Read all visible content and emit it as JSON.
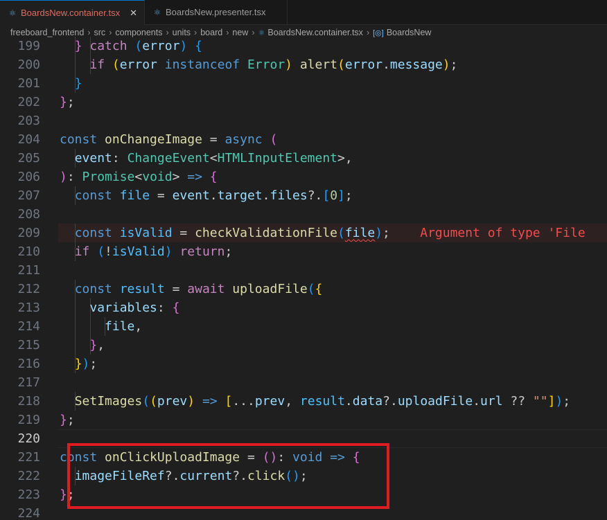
{
  "tabs": [
    {
      "label": "BoardsNew.container.tsx",
      "icon": "react-icon",
      "active": true,
      "close": "✕"
    },
    {
      "label": "BoardsNew.presenter.tsx",
      "icon": "react-icon",
      "active": false
    }
  ],
  "breadcrumb": [
    "freeboard_frontend",
    "src",
    "components",
    "units",
    "board",
    "new",
    "BoardsNew.container.tsx",
    "BoardsNew"
  ],
  "error_message": "Argument of type 'File",
  "lines": [
    {
      "n": "199",
      "t": [
        [
          "  ",
          "p"
        ],
        [
          "} ",
          "b2"
        ],
        [
          "catch ",
          "ctl"
        ],
        [
          "(",
          "b3"
        ],
        [
          "error",
          "var"
        ],
        [
          ") ",
          "b3"
        ],
        [
          "{",
          "b3"
        ]
      ]
    },
    {
      "n": "200",
      "t": [
        [
          "    ",
          "p"
        ],
        [
          "if ",
          "ctl"
        ],
        [
          "(",
          "b1"
        ],
        [
          "error ",
          "var"
        ],
        [
          "instanceof ",
          "kw"
        ],
        [
          "Error",
          "typ"
        ],
        [
          ") ",
          "b1"
        ],
        [
          "alert",
          "fn"
        ],
        [
          "(",
          "b1"
        ],
        [
          "error",
          "var"
        ],
        [
          ".",
          "p"
        ],
        [
          "message",
          "var"
        ],
        [
          ")",
          "b1"
        ],
        [
          ";",
          "p"
        ]
      ]
    },
    {
      "n": "201",
      "t": [
        [
          "  ",
          "p"
        ],
        [
          "}",
          "b3"
        ]
      ]
    },
    {
      "n": "202",
      "t": [
        [
          "}",
          "b2"
        ],
        [
          ";",
          "p"
        ]
      ]
    },
    {
      "n": "203",
      "t": []
    },
    {
      "n": "204",
      "t": [
        [
          "const ",
          "kw"
        ],
        [
          "onChangeImage",
          "fn"
        ],
        [
          " = ",
          "p"
        ],
        [
          "async ",
          "kw"
        ],
        [
          "(",
          "b2"
        ]
      ]
    },
    {
      "n": "205",
      "t": [
        [
          "  ",
          "p"
        ],
        [
          "event",
          "var"
        ],
        [
          ": ",
          "p"
        ],
        [
          "ChangeEvent",
          "typ"
        ],
        [
          "<",
          "p"
        ],
        [
          "HTMLInputElement",
          "typ"
        ],
        [
          ">",
          "p"
        ],
        [
          ",",
          "p"
        ]
      ]
    },
    {
      "n": "206",
      "t": [
        [
          ")",
          "b2"
        ],
        [
          ": ",
          "p"
        ],
        [
          "Promise",
          "typ"
        ],
        [
          "<",
          "p"
        ],
        [
          "void",
          "typ"
        ],
        [
          "> ",
          "p"
        ],
        [
          "=> ",
          "kw"
        ],
        [
          "{",
          "b2"
        ]
      ]
    },
    {
      "n": "207",
      "t": [
        [
          "  ",
          "p"
        ],
        [
          "const ",
          "kw"
        ],
        [
          "file",
          "cst"
        ],
        [
          " = ",
          "p"
        ],
        [
          "event",
          "var"
        ],
        [
          ".",
          "p"
        ],
        [
          "target",
          "var"
        ],
        [
          ".",
          "p"
        ],
        [
          "files",
          "var"
        ],
        [
          "?.",
          "p"
        ],
        [
          "[",
          "b3"
        ],
        [
          "0",
          "num"
        ],
        [
          "]",
          "b3"
        ],
        [
          ";",
          "p"
        ]
      ]
    },
    {
      "n": "208",
      "t": []
    },
    {
      "n": "209",
      "error": true,
      "t": [
        [
          "  ",
          "p"
        ],
        [
          "const ",
          "kw"
        ],
        [
          "isValid",
          "cst"
        ],
        [
          " = ",
          "p"
        ],
        [
          "checkValidationFile",
          "fn"
        ],
        [
          "(",
          "b3"
        ],
        [
          "file",
          "var squig"
        ],
        [
          ")",
          "b3"
        ],
        [
          ";",
          "p"
        ]
      ]
    },
    {
      "n": "210",
      "t": [
        [
          "  ",
          "p"
        ],
        [
          "if ",
          "ctl"
        ],
        [
          "(",
          "b3"
        ],
        [
          "!",
          "p"
        ],
        [
          "isValid",
          "cst"
        ],
        [
          ") ",
          "b3"
        ],
        [
          "return",
          "ctl"
        ],
        [
          ";",
          "p"
        ]
      ]
    },
    {
      "n": "211",
      "t": []
    },
    {
      "n": "212",
      "t": [
        [
          "  ",
          "p"
        ],
        [
          "const ",
          "kw"
        ],
        [
          "result",
          "cst"
        ],
        [
          " = ",
          "p"
        ],
        [
          "await ",
          "ctl"
        ],
        [
          "uploadFile",
          "fn"
        ],
        [
          "(",
          "b3"
        ],
        [
          "{",
          "b1"
        ]
      ]
    },
    {
      "n": "213",
      "t": [
        [
          "    ",
          "p"
        ],
        [
          "variables",
          "var"
        ],
        [
          ": ",
          "p"
        ],
        [
          "{",
          "b2"
        ]
      ]
    },
    {
      "n": "214",
      "t": [
        [
          "      ",
          "p"
        ],
        [
          "file",
          "var"
        ],
        [
          ",",
          "p"
        ]
      ]
    },
    {
      "n": "215",
      "t": [
        [
          "    ",
          "p"
        ],
        [
          "}",
          "b2"
        ],
        [
          ",",
          "p"
        ]
      ]
    },
    {
      "n": "216",
      "t": [
        [
          "  ",
          "p"
        ],
        [
          "}",
          "b1"
        ],
        [
          ")",
          "b3"
        ],
        [
          ";",
          "p"
        ]
      ]
    },
    {
      "n": "217",
      "t": []
    },
    {
      "n": "218",
      "t": [
        [
          "  ",
          "p"
        ],
        [
          "SetImages",
          "fn"
        ],
        [
          "(",
          "b3"
        ],
        [
          "(",
          "b1"
        ],
        [
          "prev",
          "var"
        ],
        [
          ") ",
          "b1"
        ],
        [
          "=> ",
          "kw"
        ],
        [
          "[",
          "b1"
        ],
        [
          "...",
          "p"
        ],
        [
          "prev",
          "var"
        ],
        [
          ", ",
          "p"
        ],
        [
          "result",
          "cst"
        ],
        [
          ".",
          "p"
        ],
        [
          "data",
          "var"
        ],
        [
          "?.",
          "p"
        ],
        [
          "uploadFile",
          "var"
        ],
        [
          ".",
          "p"
        ],
        [
          "url",
          "var"
        ],
        [
          " ?? ",
          "p"
        ],
        [
          "\"\"",
          "str"
        ],
        [
          "]",
          "b1"
        ],
        [
          ")",
          "b3"
        ],
        [
          ";",
          "p"
        ]
      ]
    },
    {
      "n": "219",
      "t": [
        [
          "}",
          "b2"
        ],
        [
          ";",
          "p"
        ]
      ]
    },
    {
      "n": "220",
      "current": true,
      "t": []
    },
    {
      "n": "221",
      "t": [
        [
          "const ",
          "kw"
        ],
        [
          "onClickUploadImage",
          "fn"
        ],
        [
          " = ",
          "p"
        ],
        [
          "(",
          "b2"
        ],
        [
          ")",
          "b2"
        ],
        [
          ": ",
          "p"
        ],
        [
          "void ",
          "kw"
        ],
        [
          "=> ",
          "kw"
        ],
        [
          "{",
          "b2"
        ]
      ]
    },
    {
      "n": "222",
      "t": [
        [
          "  ",
          "p"
        ],
        [
          "imageFileRef",
          "var"
        ],
        [
          "?.",
          "p"
        ],
        [
          "current",
          "var"
        ],
        [
          "?.",
          "p"
        ],
        [
          "click",
          "fn"
        ],
        [
          "(",
          "b3"
        ],
        [
          ")",
          "b3"
        ],
        [
          ";",
          "p"
        ]
      ]
    },
    {
      "n": "223",
      "t": [
        [
          "}",
          "b2"
        ],
        [
          ";",
          "p"
        ]
      ]
    },
    {
      "n": "224",
      "t": []
    }
  ]
}
